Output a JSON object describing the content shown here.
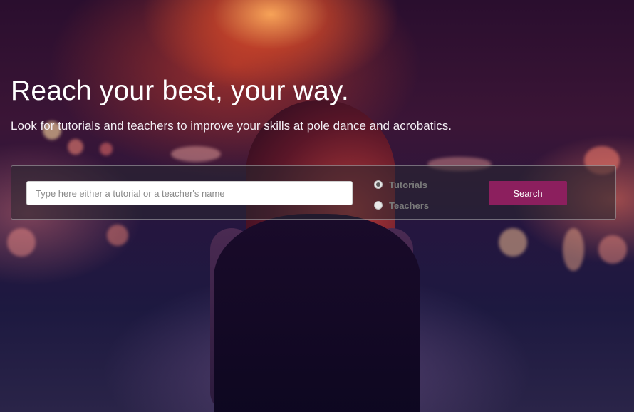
{
  "hero": {
    "headline": "Reach your best, your way.",
    "subline": "Look for tutorials and teachers to improve your skills at pole dance and acrobatics."
  },
  "search": {
    "placeholder": "Type here either a tutorial or a teacher's name",
    "value": "",
    "button_label": "Search",
    "options": [
      {
        "label": "Tutorials",
        "checked": true
      },
      {
        "label": "Teachers",
        "checked": false
      }
    ]
  },
  "colors": {
    "accent": "#8c1f5e",
    "text": "#ffffff",
    "panel": "rgba(40,40,48,0.55)"
  }
}
